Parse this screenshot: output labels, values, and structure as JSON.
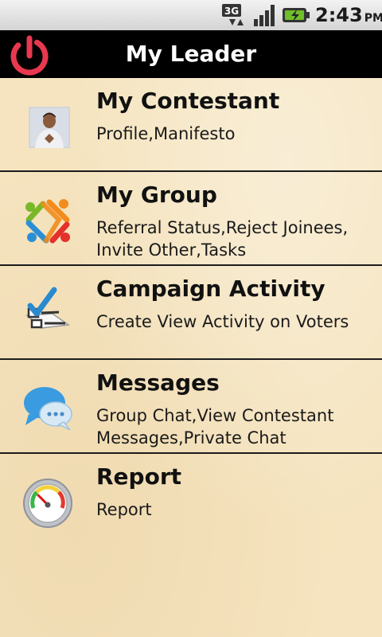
{
  "status_bar": {
    "network_icon": "3g-icon",
    "signal_icon": "signal-icon",
    "battery_icon": "battery-charging-icon",
    "time": "2:43",
    "ampm": "PM"
  },
  "app_bar": {
    "title": "My Leader",
    "power_icon": "power-icon",
    "accent_color": "#e8384f"
  },
  "menu": [
    {
      "icon": "contestant-photo-icon",
      "title": "My Contestant",
      "description": "Profile,Manifesto"
    },
    {
      "icon": "group-icon",
      "title": "My Group",
      "description": "Referral Status,Reject Joinees, Invite Other,Tasks"
    },
    {
      "icon": "checklist-icon",
      "title": "Campaign Activity",
      "description": "Create View Activity on Voters"
    },
    {
      "icon": "chat-bubble-icon",
      "title": "Messages",
      "description": "Group Chat,View Contestant Messages,Private Chat"
    },
    {
      "icon": "gauge-icon",
      "title": "Report",
      "description": "Report"
    }
  ]
}
